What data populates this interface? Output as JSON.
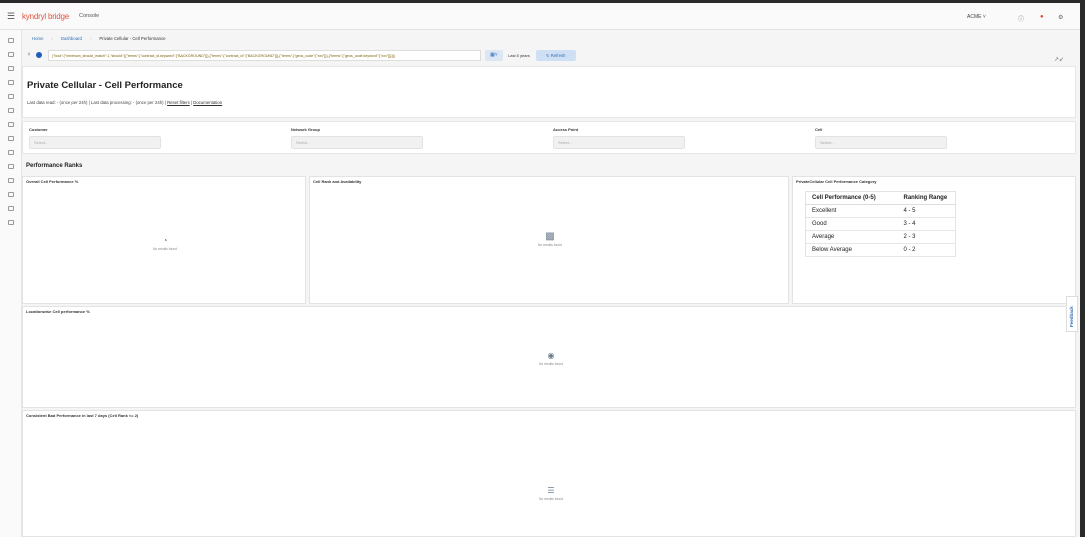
{
  "topbar": {
    "brand_prefix": "kyndryl",
    "brand_suffix": "bridge",
    "console": "Console",
    "user": "ACME"
  },
  "breadcrumb": [
    "Home",
    "Dashboard",
    "Private Cellular - Cell Performance"
  ],
  "query": {
    "text": "(\"bool\":{\"minimum_should_match\":1,\"should\":[{\"terms\":{\"contract_id.keyword\":[\"BACKGROUND\"]}},{\"terms\":{\"contract_id\":[\"BACKGROUND\"]}},{\"terms\":{\"geos_code\":[\"xxx\"]}},{\"terms\":{\"geos_code.keyword\":[\"xxx\"]}}]})",
    "range": "Last 5 years",
    "refresh": "Refresh"
  },
  "page": {
    "title": "Private Cellular - Cell Performance",
    "subline_prefix": "Last data read: - (once per 24h) | Last data processing: - (once per 24h) |",
    "reset_filters": "Reset filters",
    "documentation": "Documentation"
  },
  "filters": [
    {
      "label": "Customer",
      "placeholder": "Select..."
    },
    {
      "label": "Network Group",
      "placeholder": "Select..."
    },
    {
      "label": "Access Point",
      "placeholder": "Select..."
    },
    {
      "label": "Cell",
      "placeholder": "Select..."
    }
  ],
  "section_title": "Performance Ranks",
  "panels": {
    "overall": {
      "title": "Overall Cell Performance %",
      "empty": "No results found"
    },
    "rank_availability": {
      "title": "Cell Rank and Availability",
      "empty": "No results found"
    },
    "category": {
      "title": "PrivateCellular Cell Performance Category"
    },
    "location": {
      "title": "Locationwise Cell performance %",
      "empty": "No results found"
    },
    "consistent": {
      "title": "Consistent Bad Performance in last 7 days (Cell Rank <= 2)",
      "empty": "No results found"
    }
  },
  "category_table": {
    "headers": [
      "Cell Performance (0-5)",
      "Ranking Range"
    ],
    "rows": [
      [
        "Excellent",
        "4 - 5"
      ],
      [
        "Good",
        "3 - 4"
      ],
      [
        "Average",
        "2 - 3"
      ],
      [
        "Below Average",
        "0 - 2"
      ]
    ]
  },
  "feedback": "Feedback"
}
